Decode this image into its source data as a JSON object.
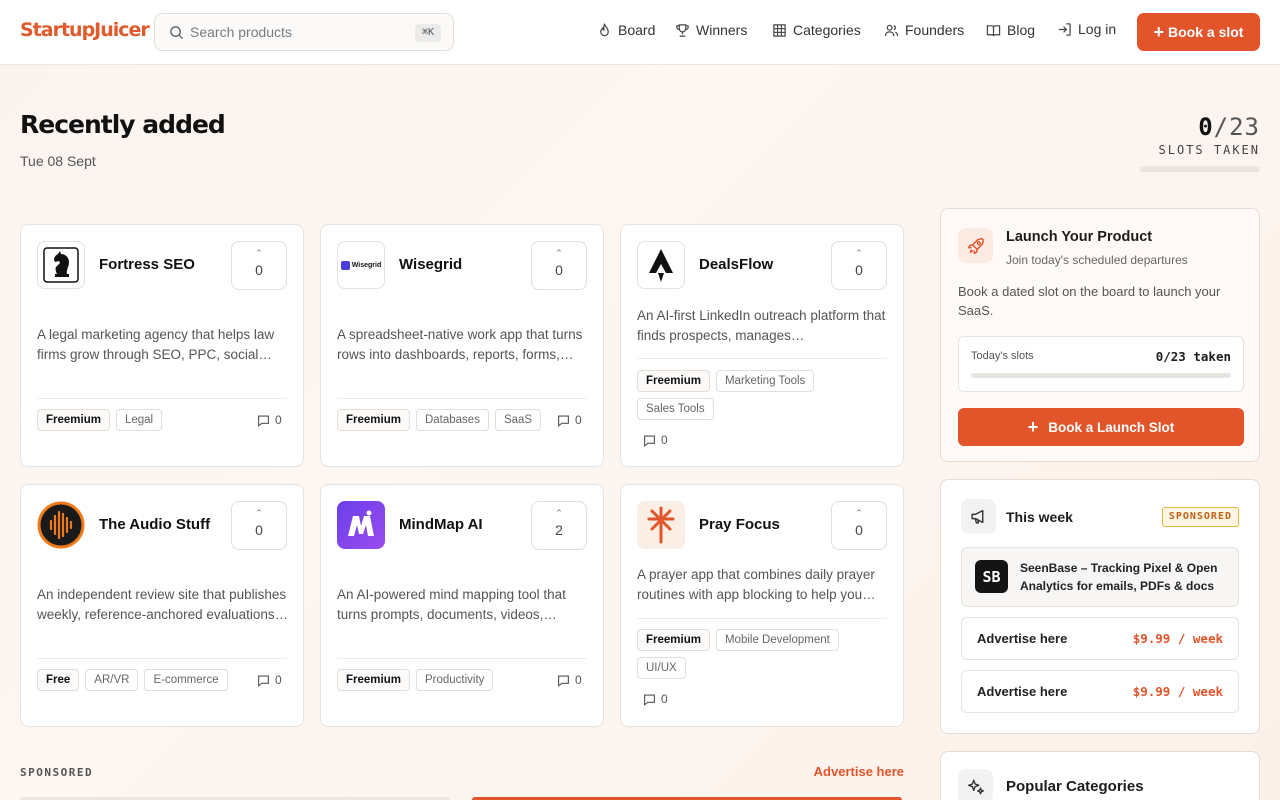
{
  "header": {
    "logo": "StartupJuicer",
    "search_placeholder": "Search products",
    "search_shortcut": "⌘K",
    "nav": [
      {
        "label": "Board",
        "icon": "flame-icon"
      },
      {
        "label": "Winners",
        "icon": "trophy-icon"
      },
      {
        "label": "Categories",
        "icon": "grid-icon"
      },
      {
        "label": "Founders",
        "icon": "users-icon"
      },
      {
        "label": "Blog",
        "icon": "book-icon"
      },
      {
        "label": "Log in",
        "icon": "login-icon"
      }
    ],
    "cta_label": "Book a slot"
  },
  "main": {
    "title": "Recently added",
    "date": "Tue 08 Sept",
    "slots_taken": "0",
    "slots_total": "/23",
    "slots_label": "SLOTS TAKEN",
    "slots_progress": 0
  },
  "products": [
    {
      "name": "Fortress SEO",
      "votes": "0",
      "description": "A legal marketing agency that helps law firms grow through SEO, PPC, social…",
      "tags": [
        "Freemium",
        "Legal"
      ],
      "comments": "0",
      "logo": "knight-logo"
    },
    {
      "name": "Wisegrid",
      "votes": "0",
      "description": "A spreadsheet-native work app that turns rows into dashboards, reports, forms,…",
      "tags": [
        "Freemium",
        "Databases",
        "SaaS"
      ],
      "comments": "0",
      "logo": "wisegrid-logo",
      "logo_text": "Wisegrid"
    },
    {
      "name": "DealsFlow",
      "votes": "0",
      "description": "An AI-first LinkedIn outreach platform that finds prospects, manages…",
      "tags": [
        "Freemium",
        "Marketing Tools",
        "Sales Tools"
      ],
      "comments": "0",
      "logo": "dealsflow-logo"
    },
    {
      "name": "The Audio Stuff",
      "votes": "0",
      "description": "An independent review site that publishes weekly, reference-anchored evaluations…",
      "tags": [
        "Free",
        "AR/VR",
        "E-commerce"
      ],
      "comments": "0",
      "logo": "audio-logo"
    },
    {
      "name": "MindMap AI",
      "votes": "2",
      "description": "An AI-powered mind mapping tool that turns prompts, documents, videos,…",
      "tags": [
        "Freemium",
        "Productivity"
      ],
      "comments": "0",
      "logo": "mindmap-logo"
    },
    {
      "name": "Pray Focus",
      "votes": "0",
      "description": "A prayer app that combines daily prayer routines with app blocking to help you…",
      "tags": [
        "Freemium",
        "Mobile Development",
        "UI/UX"
      ],
      "comments": "0",
      "logo": "prayfocus-logo"
    }
  ],
  "sponsored": {
    "label": "SPONSORED",
    "advertise_link": "Advertise here"
  },
  "launch": {
    "title": "Launch Your Product",
    "subtitle": "Join today's scheduled departures",
    "body": "Book a dated slot on the board to launch your SaaS.",
    "today_label": "Today's slots",
    "today_value": "0/23 taken",
    "button": "Book a Launch Slot"
  },
  "week": {
    "title": "This week",
    "badge": "SPONSORED",
    "sponsor_logo": "SB",
    "sponsor_title": "SeenBase – Tracking Pixel & Open Analytics for emails, PDFs & docs",
    "ads": [
      {
        "label": "Advertise here",
        "price": "$9.99 / week"
      },
      {
        "label": "Advertise here",
        "price": "$9.99 / week"
      }
    ]
  },
  "popular": {
    "title": "Popular Categories"
  },
  "colors": {
    "accent": "#e2542a",
    "logo": "#e05a2b",
    "badge_border": "#e9b53c"
  }
}
